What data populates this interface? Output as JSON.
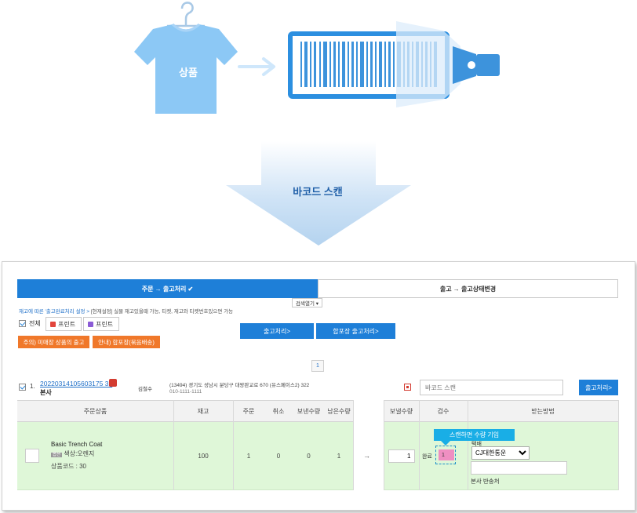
{
  "illustration": {
    "product_label": "상품",
    "scan_label": "바코드 스캔",
    "colors": {
      "shirt": "#8cc8f5",
      "scanner_frame": "#2c8fe0",
      "arrow": "#cfe7fb"
    }
  },
  "tabs": [
    {
      "label": "주문 → 출고처리 ✔",
      "active": true
    },
    {
      "label": "출고 → 출고상태변경",
      "active": false
    }
  ],
  "search_toggle": "검색열기 ▾",
  "settings": {
    "link": "재고에 따른 '출고완료처리 설정 >",
    "current": "[현재설정] 실물 재고있을때 가능,  티켓, 재고와 티켓번호있으면 가능"
  },
  "select_all_label": "전체",
  "print_buttons": [
    "프린트",
    "프린트"
  ],
  "warning_buttons": [
    "주의) 미매장 상품의 출고",
    "안내) 합포장(묶음배송)"
  ],
  "action_buttons": {
    "ship": "출고처리>",
    "combined_ship": "합포장 출고처리>"
  },
  "pagination": {
    "current": "1"
  },
  "order": {
    "index": "1.",
    "order_number": "20220314105603175 32",
    "store": "본사",
    "customer": "김철수",
    "address": "(13494) 경기도 성남시 분당구 대왕판교로 670 (유스페이스2) 322",
    "phone": "010-1111-1111",
    "barcode_placeholder": "바코드 스캔",
    "ship_button": "출고처리>"
  },
  "table": {
    "headers": [
      "주문상품",
      "재고",
      "주문",
      "취소",
      "보낸수량",
      "남은수량",
      "보낼수량",
      "검수",
      "받는방법"
    ],
    "row": {
      "product_name": "Basic Trench Coat",
      "option_badge": "옵션",
      "option_text": "색상:오렌지",
      "product_code": "상품코드 : 30",
      "stock": "100",
      "ordered": "1",
      "cancelled": "0",
      "sent": "0",
      "remaining": "1",
      "arrow": "→",
      "send_qty": "1",
      "inspection_label": "완료",
      "inspection_value": "1",
      "courier_label": "택배",
      "courier": "CJ대한통운",
      "return_address_label": "본사 반송처"
    }
  },
  "tooltip": "스캔하면 수량 기입"
}
